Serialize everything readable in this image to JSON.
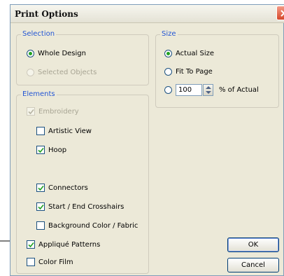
{
  "window": {
    "title": "Print Options"
  },
  "selection": {
    "legend": "Selection",
    "whole_design": {
      "label": "Whole Design",
      "checked": true
    },
    "selected_objects": {
      "label": "Selected Objects",
      "checked": false,
      "disabled": true
    }
  },
  "size": {
    "legend": "Size",
    "actual_size": {
      "label": "Actual Size",
      "checked": true
    },
    "fit_to_page": {
      "label": "Fit To Page",
      "checked": false
    },
    "percent": {
      "checked": false,
      "value": "100",
      "suffix": "% of Actual"
    }
  },
  "elements": {
    "legend": "Elements",
    "embroidery": {
      "label": "Embroidery",
      "checked": true,
      "disabled": true
    },
    "artistic_view": {
      "label": "Artistic View",
      "checked": false
    },
    "hoop": {
      "label": "Hoop",
      "checked": true
    },
    "connectors": {
      "label": "Connectors",
      "checked": true
    },
    "crosshairs": {
      "label": "Start / End Crosshairs",
      "checked": true
    },
    "background": {
      "label": "Background Color / Fabric",
      "checked": false
    },
    "applique": {
      "label": "Appliqué Patterns",
      "checked": true
    },
    "color_film": {
      "label": "Color Film",
      "checked": false
    }
  },
  "buttons": {
    "ok": "OK",
    "cancel": "Cancel"
  },
  "icons": {
    "close": "close-icon",
    "pointer": "arrow-icon",
    "spinner": "up-down-icon"
  },
  "colors": {
    "legend_text": "#2255d4",
    "close_button": "#d6482b",
    "radio_dot": "#21a121"
  }
}
